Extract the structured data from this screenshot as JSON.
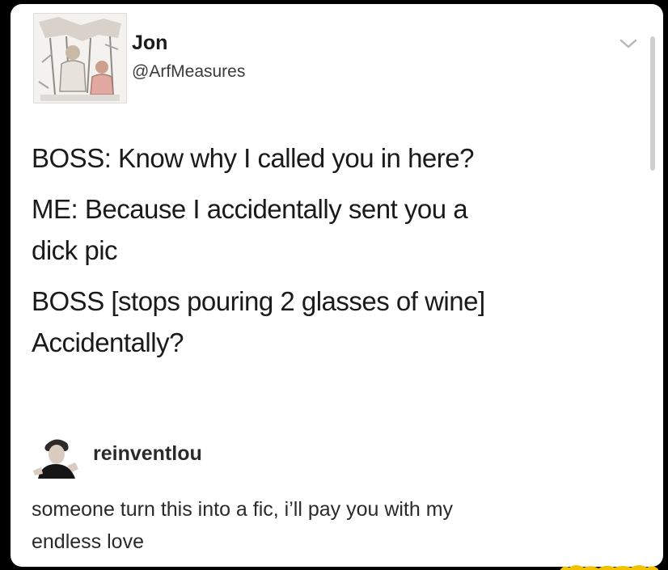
{
  "post": {
    "author": {
      "name": "Jon",
      "handle": "@ArfMeasures",
      "avatar_icon": "profile-photo"
    },
    "menu_icon": "chevron-down-icon",
    "text_lines": [
      "BOSS: Know why I called you in here?",
      "ME: Because I accidentally sent you a",
      "dick pic",
      "BOSS [stops pouring 2 glasses of wine]",
      "Accidentally?"
    ]
  },
  "reply": {
    "username": "reinventlou",
    "avatar_icon": "profile-photo",
    "text_lines": [
      "someone turn this into a fic, i’ll pay you with my",
      "endless love"
    ]
  },
  "colors": {
    "background": "#000000",
    "card": "#ffffff",
    "text": "#1a1a1a",
    "watermark": "#f2c100"
  }
}
